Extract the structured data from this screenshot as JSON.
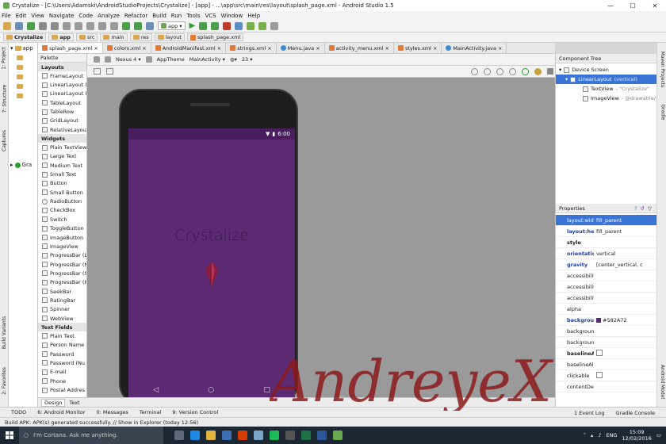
{
  "window": {
    "title": "Crystalize - [C:\\Users\\Adamski\\AndroidStudioProjects\\Crystalize] - [app] - ...\\app\\src\\main\\res\\layout\\splash_page.xml - Android Studio 1.5",
    "controls": [
      "—",
      "☐",
      "✕"
    ]
  },
  "menu": [
    "File",
    "Edit",
    "View",
    "Navigate",
    "Code",
    "Analyze",
    "Refactor",
    "Build",
    "Run",
    "Tools",
    "VCS",
    "Window",
    "Help"
  ],
  "toolbar": {
    "run_config": "app"
  },
  "breadcrumb": [
    "Crystalize",
    "app",
    "src",
    "main",
    "res",
    "layout",
    "splash_page.xml"
  ],
  "left_tool_windows": [
    "1: Project",
    "7: Structure",
    "Captures",
    "Build Variants",
    "2: Favorites"
  ],
  "right_tool_windows": [
    "Maven Projects",
    "Gradle",
    "Android Model"
  ],
  "project_pane": {
    "root": "app",
    "gradle_label": "Gra"
  },
  "editor_tabs": [
    {
      "label": "splash_page.xml",
      "kind": "xml",
      "active": true
    },
    {
      "label": "colors.xml",
      "kind": "xml",
      "active": false
    },
    {
      "label": "AndroidManifest.xml",
      "kind": "xml",
      "active": false
    },
    {
      "label": "strings.xml",
      "kind": "xml",
      "active": false
    },
    {
      "label": "Menu.java",
      "kind": "java",
      "active": false
    },
    {
      "label": "activity_menu.xml",
      "kind": "xml",
      "active": false
    },
    {
      "label": "styles.xml",
      "kind": "xml",
      "active": false
    },
    {
      "label": "MainActivity.java",
      "kind": "java",
      "active": false
    }
  ],
  "palette": {
    "title": "Palette",
    "categories": [
      {
        "name": "Layouts",
        "items": [
          "FrameLayout",
          "LinearLayout (H",
          "LinearLayout (V",
          "TableLayout",
          "TableRow",
          "GridLayout",
          "RelativeLayout"
        ]
      },
      {
        "name": "Widgets",
        "items": [
          "Plain TextView",
          "Large Text",
          "Medium Text",
          "Small Text",
          "Button",
          "Small Button",
          "RadioButton",
          "CheckBox",
          "Switch",
          "ToggleButton",
          "ImageButton",
          "ImageView",
          "ProgressBar (L",
          "ProgressBar (N",
          "ProgressBar (S",
          "ProgressBar (H",
          "SeekBar",
          "RatingBar",
          "Spinner",
          "WebView"
        ]
      },
      {
        "name": "Text Fields",
        "items": [
          "Plain Text",
          "Person Name",
          "Password",
          "Password (Nu",
          "E-mail",
          "Phone",
          "Postal Addres"
        ]
      }
    ]
  },
  "designer_toolbar": {
    "device": "Nexus 4",
    "theme": "AppTheme",
    "activity": "MainActivity",
    "api": "23"
  },
  "device_preview": {
    "time": "6:00",
    "app_text": "Crystalize",
    "screen_color": "#5C2A72"
  },
  "design_tabs": [
    {
      "label": "Design",
      "active": true
    },
    {
      "label": "Text",
      "active": false
    }
  ],
  "component_tree": {
    "title": "Component Tree",
    "rows": [
      {
        "label": "Device Screen",
        "detail": "",
        "selected": false
      },
      {
        "label": "LinearLayout",
        "detail": "(vertical)",
        "selected": true
      },
      {
        "label": "TextView",
        "detail": "- \"Crystalize\"",
        "selected": false
      },
      {
        "label": "ImageView",
        "detail": "- @drawable/",
        "selected": false
      }
    ]
  },
  "properties": {
    "title": "Properties",
    "rows": [
      {
        "name": "layout:width",
        "value": "fill_parent",
        "style": "selected"
      },
      {
        "name": "layout:height",
        "value": "fill_parent",
        "style": "blue"
      },
      {
        "name": "style",
        "value": "",
        "style": "bold"
      },
      {
        "name": "orientation",
        "value": "vertical",
        "style": "blue"
      },
      {
        "name": "gravity",
        "value": "[center_vertical, c",
        "style": "blue"
      },
      {
        "name": "accessibilityLive",
        "value": "",
        "style": ""
      },
      {
        "name": "accessibilityTra",
        "value": "",
        "style": ""
      },
      {
        "name": "accessibilityTra",
        "value": "",
        "style": ""
      },
      {
        "name": "alpha",
        "value": "",
        "style": ""
      },
      {
        "name": "background",
        "value": "#582A72",
        "style": "blue"
      },
      {
        "name": "backgroundTin",
        "value": "",
        "style": ""
      },
      {
        "name": "backgroundTin",
        "value": "",
        "style": ""
      },
      {
        "name": "baselineAlign",
        "value": "",
        "style": "bold"
      },
      {
        "name": "baselineAligne",
        "value": "",
        "style": ""
      },
      {
        "name": "clickable",
        "value": "",
        "style": ""
      },
      {
        "name": "contentDescrip",
        "value": "",
        "style": ""
      }
    ]
  },
  "bottom_tabs": [
    "TODO",
    "6: Android Monitor",
    "0: Messages",
    "Terminal",
    "9: Version Control"
  ],
  "bottom_tabs_right": [
    "1 Event Log",
    "Gradle Console"
  ],
  "status_message": "Build APK: APK(s) generated successfully. // Show in Explorer (today 12:56)",
  "taskbar": {
    "search_placeholder": "I'm Cortana. Ask me anything.",
    "language": "ENG",
    "time": "15:09",
    "date": "12/02/2016"
  },
  "watermark": "AndreyeX"
}
